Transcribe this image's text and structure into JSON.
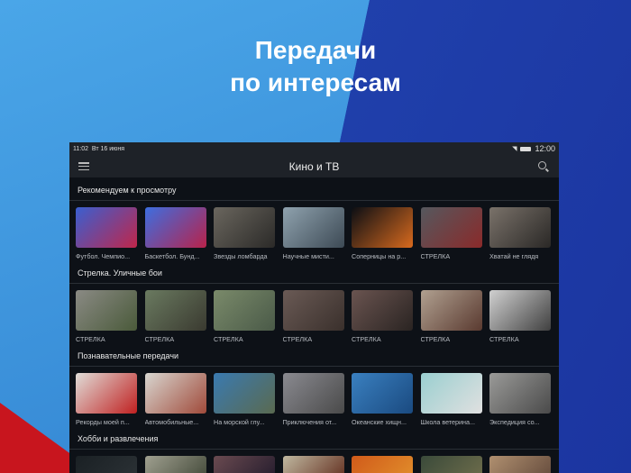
{
  "headline": {
    "line1": "Передачи",
    "line2": "по интересам"
  },
  "status": {
    "time": "11:02",
    "date": "Вт 16 июня",
    "clock": "12:00"
  },
  "appbar": {
    "title": "Кино и ТВ"
  },
  "sections": [
    {
      "title": "Рекомендуем к просмотру",
      "items": [
        {
          "label": "Футбол. Чемпио...",
          "colors": [
            "#3a5fd0",
            "#c0264a"
          ]
        },
        {
          "label": "Баскетбол. Бунд...",
          "colors": [
            "#3d6ee0",
            "#b8224a"
          ]
        },
        {
          "label": "Звезды ломбарда",
          "colors": [
            "#6a665e",
            "#2b2a28"
          ]
        },
        {
          "label": "Научные мисти...",
          "colors": [
            "#8fa2ae",
            "#3d4a55"
          ]
        },
        {
          "label": "Соперницы на р...",
          "colors": [
            "#0b0e14",
            "#d86a1e"
          ]
        },
        {
          "label": "СТРЕЛКА",
          "colors": [
            "#55585e",
            "#8a2a2a"
          ]
        },
        {
          "label": "Хватай не глядя",
          "colors": [
            "#7a726a",
            "#2a2826"
          ]
        }
      ]
    },
    {
      "title": "Стрелка. Уличные бои",
      "items": [
        {
          "label": "СТРЕЛКА",
          "colors": [
            "#8a8a84",
            "#4a5a3a"
          ]
        },
        {
          "label": "СТРЕЛКА",
          "colors": [
            "#6a7a60",
            "#3a3a30"
          ]
        },
        {
          "label": "СТРЕЛКА",
          "colors": [
            "#7a8a6a",
            "#4a5a48"
          ]
        },
        {
          "label": "СТРЕЛКА",
          "colors": [
            "#6a5a55",
            "#3a302c"
          ]
        },
        {
          "label": "СТРЕЛКА",
          "colors": [
            "#6a5450",
            "#2a2422"
          ]
        },
        {
          "label": "СТРЕЛКА",
          "colors": [
            "#b0a090",
            "#5a3a30"
          ]
        },
        {
          "label": "СТРЕЛКА",
          "colors": [
            "#d0d0d0",
            "#404040"
          ]
        }
      ]
    },
    {
      "title": "Познавательные передачи",
      "items": [
        {
          "label": "Рекорды моей п...",
          "colors": [
            "#e0ddd8",
            "#c02020"
          ]
        },
        {
          "label": "Автомобильные...",
          "colors": [
            "#d8d6d0",
            "#a04a3a"
          ]
        },
        {
          "label": "На морской глу...",
          "colors": [
            "#3a7ab0",
            "#5a6a50"
          ]
        },
        {
          "label": "Приключения от...",
          "colors": [
            "#8a8a90",
            "#4a4a4a"
          ]
        },
        {
          "label": "Океанские хищн...",
          "colors": [
            "#3a80c0",
            "#1a4a80"
          ]
        },
        {
          "label": "Школа ветерина...",
          "colors": [
            "#9acfd0",
            "#e0e0e0"
          ]
        },
        {
          "label": "Экспедиция со...",
          "colors": [
            "#9a9a98",
            "#4a4a4a"
          ]
        }
      ]
    },
    {
      "title": "Хобби и развлечения",
      "items": [
        {
          "label": "",
          "colors": [
            "#1a2024",
            "#2a3034"
          ]
        },
        {
          "label": "",
          "colors": [
            "#a0a090",
            "#4a5040"
          ]
        },
        {
          "label": "",
          "colors": [
            "#6a4a50",
            "#2a2030"
          ]
        },
        {
          "label": "",
          "colors": [
            "#c0b8a0",
            "#6a3a2a"
          ]
        },
        {
          "label": "",
          "colors": [
            "#d05a1a",
            "#e08a2a"
          ]
        },
        {
          "label": "",
          "colors": [
            "#3a4a3a",
            "#6a6a4a"
          ]
        },
        {
          "label": "",
          "colors": [
            "#b09070",
            "#6a5040"
          ]
        }
      ]
    }
  ]
}
